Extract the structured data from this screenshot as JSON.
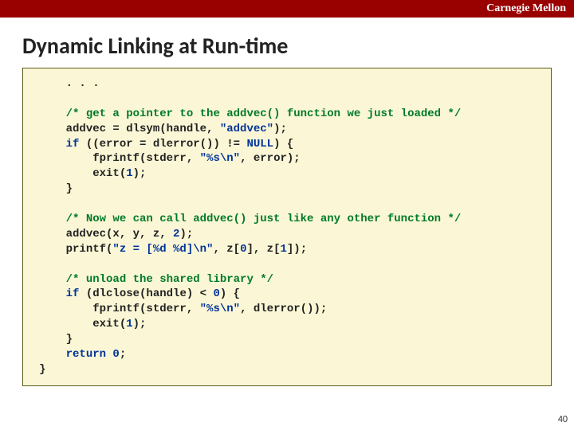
{
  "banner": {
    "org": "Carnegie Mellon"
  },
  "title": "Dynamic Linking at Run-time",
  "code": {
    "l01": ". . .",
    "l02": "",
    "l03": "/* get a pointer to the addvec() function we just loaded */",
    "l04a": "addvec = dlsym(handle, ",
    "l04b": "\"addvec\"",
    "l04c": ");",
    "l05a": "if",
    "l05b": " ((error = dlerror()) != ",
    "l05c": "NULL",
    "l05d": ") {",
    "l06a": "    fprintf(stderr, ",
    "l06b": "\"%s\\n\"",
    "l06c": ", error);",
    "l07a": "    exit(",
    "l07b": "1",
    "l07c": ");",
    "l08": "}",
    "l09": "",
    "l10": "/* Now we can call addvec() just like any other function */",
    "l11a": "addvec(x, y, z, ",
    "l11b": "2",
    "l11c": ");",
    "l12a": "printf(",
    "l12b": "\"z = [%d %d]\\n\"",
    "l12c": ", z[",
    "l12d": "0",
    "l12e": "], z[",
    "l12f": "1",
    "l12g": "]);",
    "l13": "",
    "l14": "/* unload the shared library */",
    "l15a": "if",
    "l15b": " (dlclose(handle) < ",
    "l15c": "0",
    "l15d": ") {",
    "l16a": "    fprintf(stderr, ",
    "l16b": "\"%s\\n\"",
    "l16c": ", dlerror());",
    "l17a": "    exit(",
    "l17b": "1",
    "l17c": ");",
    "l18": "}",
    "l19a": "return",
    "l19b": " 0",
    "l19c": ";",
    "close": "}"
  },
  "pageno": "40"
}
